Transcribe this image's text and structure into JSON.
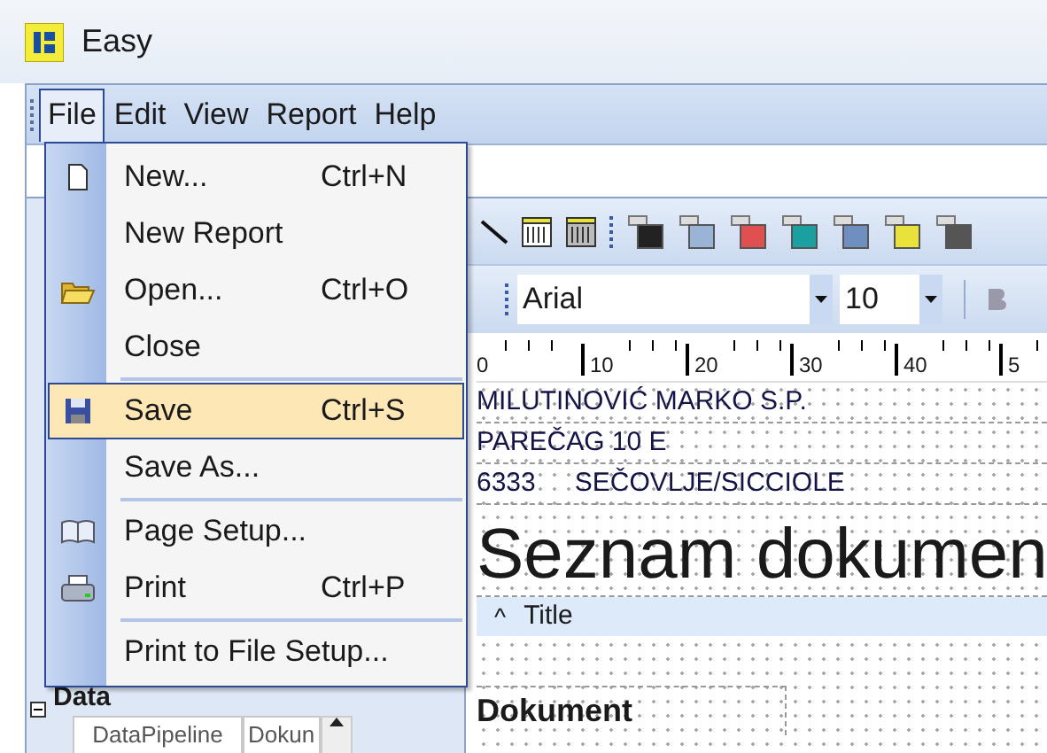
{
  "window": {
    "title": "Easy"
  },
  "menu_bar": [
    {
      "label": "File",
      "selected": true
    },
    {
      "label": "Edit",
      "selected": false
    },
    {
      "label": "View",
      "selected": false
    },
    {
      "label": "Report",
      "selected": false
    },
    {
      "label": "Help",
      "selected": false
    }
  ],
  "file_menu": [
    {
      "kind": "item",
      "label": "New...",
      "shortcut": "Ctrl+N",
      "selected": false
    },
    {
      "kind": "item",
      "label": "New Report",
      "selected": false
    },
    {
      "kind": "item",
      "label": "Open...",
      "shortcut": "Ctrl+O",
      "selected": false
    },
    {
      "kind": "item",
      "label": "Close",
      "selected": false
    },
    {
      "kind": "separator"
    },
    {
      "kind": "item",
      "label": "Save",
      "shortcut": "Ctrl+S",
      "selected": true
    },
    {
      "kind": "item",
      "label": "Save As...",
      "selected": false
    },
    {
      "kind": "separator"
    },
    {
      "kind": "item",
      "label": "Page Setup...",
      "selected": false
    },
    {
      "kind": "item",
      "label": "Print",
      "shortcut": "Ctrl+P",
      "selected": false
    },
    {
      "kind": "separator"
    },
    {
      "kind": "item",
      "label": "Print to File Setup...",
      "selected": false
    }
  ],
  "format_toolbar": {
    "font": "Arial",
    "size": "10"
  },
  "ruler": [
    "0",
    "10",
    "20",
    "30",
    "40",
    "5"
  ],
  "report": {
    "header_lines": [
      {
        "texts": [
          "MILUTINOVIĆ MARKO S.P."
        ]
      },
      {
        "texts": [
          "PAREČAG 10 E"
        ]
      },
      {
        "texts": [
          "6333",
          "SEČOVLJE/SICCIOLE"
        ]
      }
    ],
    "title": "Seznam dokumen",
    "band": {
      "arrow": "^",
      "label": "Title"
    },
    "column_heading": "Dokument"
  },
  "data_panel": {
    "heading": "Data",
    "row": [
      "DataPipeline",
      "Dokun"
    ]
  }
}
